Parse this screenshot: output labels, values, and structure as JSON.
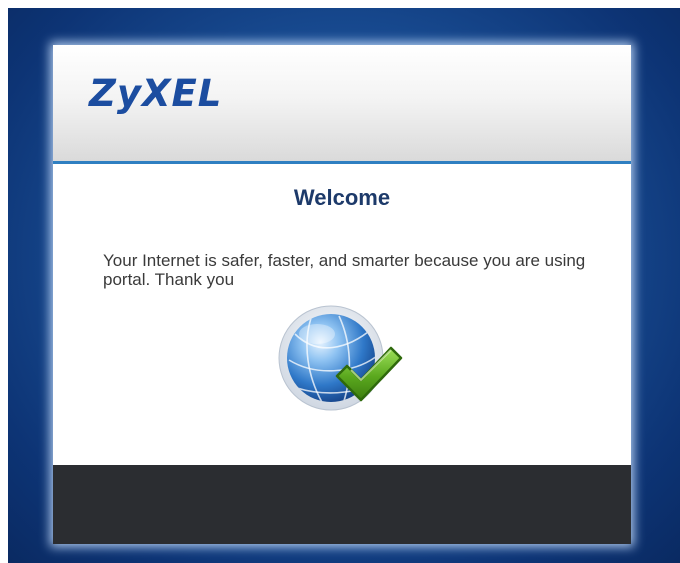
{
  "header": {
    "logo_text": "ZyXEL"
  },
  "main": {
    "title": "Welcome",
    "message": "Your Internet is safer, faster, and smarter because you are using portal. Thank you",
    "status_icon": "globe-checkmark-icon"
  },
  "colors": {
    "backdrop": "#1a4f96",
    "logo": "#1c4da0",
    "header_rule": "#2f7fc1",
    "title": "#1d3a6a",
    "footer": "#2b2d31",
    "checkmark": "#5aa81e"
  }
}
